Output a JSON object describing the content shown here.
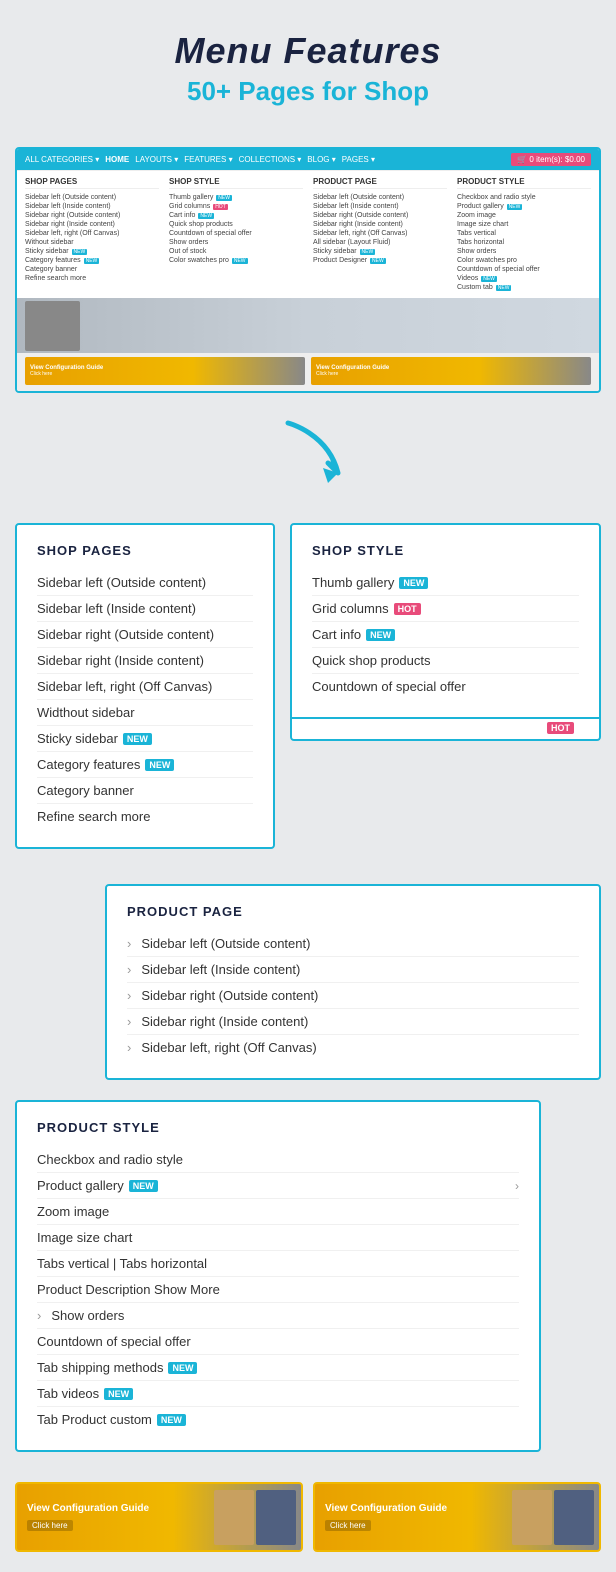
{
  "header": {
    "title": "Menu Features",
    "subtitle": "50+ Pages for Shop"
  },
  "preview": {
    "nav_items": [
      "ALL CATEGORIES",
      "HOME",
      "LAYOUTS",
      "FEATURES",
      "COLLECTIONS",
      "BLOG",
      "PAGES"
    ],
    "cart": "0 item(s): $0.00",
    "columns": [
      {
        "title": "SHOP PAGES",
        "items": [
          "Sidebar left (Outside content)",
          "Sidebar left (Inside content)",
          "Sidebar right (Outside content)",
          "Sidebar right (Inside content)",
          "Sidebar left, right (Off Canvas)",
          "Without sidebar",
          "Sticky sidebar NEW",
          "Category features NEW",
          "Category banner",
          "Refine search more"
        ]
      },
      {
        "title": "SHOP STYLE",
        "items": [
          "Thumb gallery NEW",
          "Grid columns HOT",
          "Cart info NEW",
          "Quick shop products",
          "Countdown of special offer",
          "Show orders",
          "Out of stock",
          "Color swatches pro NEW"
        ]
      },
      {
        "title": "PRODUCT PAGE",
        "items": [
          "Sidebar left (Outside content)",
          "Sidebar left (Inside content)",
          "Sidebar right (Outside content)",
          "Sidebar right (Inside content)",
          "Sidebar left, right (Off Canvas)",
          "All sidebar (Layout Fluid)",
          "Sticky sidebar NEW",
          "Product Designer NEW"
        ]
      },
      {
        "title": "PRODUCT STYLE",
        "items": [
          "Checkbox and radio style",
          "Product gallery NEW",
          "Zoom image",
          "Image size chart",
          "Tabs vertical",
          "Tabs horizontal",
          "Show orders",
          "Color swatches pro",
          "Countdown of special offer",
          "Videos NEW",
          "Custom tab NEW"
        ]
      }
    ]
  },
  "shop_pages": {
    "title": "SHOP PAGES",
    "items": [
      {
        "label": "Sidebar left (Outside content)",
        "badge": null,
        "arrow": false
      },
      {
        "label": "Sidebar left (Inside content)",
        "badge": null,
        "arrow": false
      },
      {
        "label": "Sidebar right (Outside content)",
        "badge": null,
        "arrow": false
      },
      {
        "label": "Sidebar right (Inside content)",
        "badge": null,
        "arrow": false
      },
      {
        "label": "Sidebar left, right (Off Canvas)",
        "badge": null,
        "arrow": false
      },
      {
        "label": "Widthout sidebar",
        "badge": null,
        "arrow": false
      },
      {
        "label": "Sticky sidebar",
        "badge": "NEW",
        "arrow": false
      },
      {
        "label": "Category features",
        "badge": "NEW",
        "arrow": false
      },
      {
        "label": "Category banner",
        "badge": null,
        "arrow": false
      },
      {
        "label": "Refine search more",
        "badge": null,
        "arrow": false
      }
    ]
  },
  "shop_style": {
    "title": "SHOP STYLE",
    "items": [
      {
        "label": "Thumb gallery",
        "badge": "NEW",
        "arrow": false
      },
      {
        "label": "Grid columns",
        "badge": "HOT",
        "arrow": false
      },
      {
        "label": "Cart info",
        "badge": "NEW",
        "arrow": false
      },
      {
        "label": "Quick shop products",
        "badge": null,
        "arrow": false
      },
      {
        "label": "Countdown of special offer",
        "badge": null,
        "arrow": false
      }
    ]
  },
  "product_page": {
    "title": "PRODUCT PAGE",
    "items": [
      {
        "label": "Sidebar left (Outside content)",
        "badge": null,
        "arrow": true
      },
      {
        "label": "Sidebar left (Inside content)",
        "badge": null,
        "arrow": true
      },
      {
        "label": "Sidebar right (Outside content)",
        "badge": null,
        "arrow": true
      },
      {
        "label": "Sidebar right (Inside content)",
        "badge": null,
        "arrow": false
      },
      {
        "label": "Sidebar left, right (Off Canvas)",
        "badge": null,
        "arrow": false
      }
    ]
  },
  "product_style": {
    "title": "PRODUCT STYLE",
    "items": [
      {
        "label": "Checkbox and radio style",
        "badge": null,
        "arrow": false
      },
      {
        "label": "Product gallery",
        "badge": "NEW",
        "arrow": true
      },
      {
        "label": "Zoom image",
        "badge": null,
        "arrow": false
      },
      {
        "label": "Image size chart",
        "badge": null,
        "arrow": false
      },
      {
        "label": "Tabs vertical | Tabs horizontal",
        "badge": null,
        "arrow": false
      },
      {
        "label": "Product Description Show More",
        "badge": null,
        "arrow": false
      },
      {
        "label": "Show orders",
        "badge": null,
        "arrow": false
      },
      {
        "label": "Countdown of special offer",
        "badge": null,
        "arrow": false
      },
      {
        "label": "Tab shipping methods",
        "badge": "NEW",
        "arrow": false
      },
      {
        "label": "Tab videos",
        "badge": "NEW",
        "arrow": false
      },
      {
        "label": "Tab Product custom",
        "badge": "NEW",
        "arrow": false
      }
    ]
  },
  "banners": [
    {
      "text": "View Configuration Guide",
      "click": "Click here"
    },
    {
      "text": "View Configuration Guide",
      "click": "Click here"
    }
  ],
  "badges": {
    "new_label": "NEW",
    "hot_label": "HOT"
  }
}
